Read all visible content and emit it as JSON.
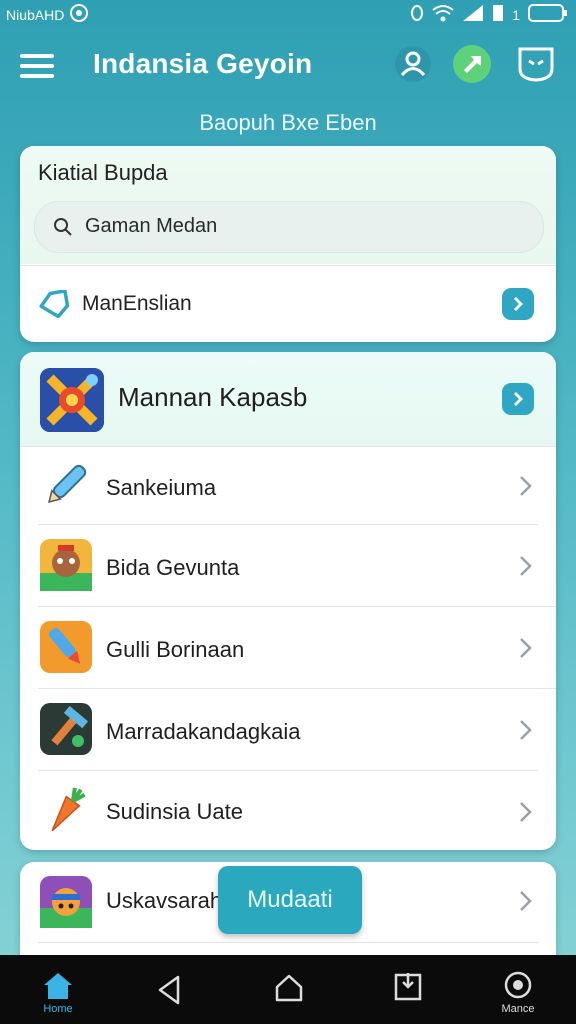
{
  "status_bar": {
    "left_text": "NiubAHD",
    "battery_text": "1"
  },
  "app_bar": {
    "title": "Indansia Geyoin"
  },
  "subtitle": "Baopuh Bxe Eben",
  "search_card": {
    "title": "Kiatial Bupda",
    "search_value": "Gaman Medan",
    "menu_label": "ManEnslian"
  },
  "apps_card": {
    "featured_label": "Mannan Kapasb",
    "items": [
      {
        "label": "Sankeiuma",
        "icon": "pencil-app-icon"
      },
      {
        "label": "Bida Gevunta",
        "icon": "character-app-icon"
      },
      {
        "label": "Gulli Borinaan",
        "icon": "brush-app-icon"
      },
      {
        "label": "Marradakandagkaia",
        "icon": "tools-app-icon"
      },
      {
        "label": "Sudinsia Uate",
        "icon": "carrot-app-icon"
      }
    ]
  },
  "bottom_card": {
    "items": [
      {
        "label": "Uskavsarah",
        "icon": "monster-app-icon"
      }
    ]
  },
  "fab": {
    "label": "Mudaati"
  },
  "navbar": {
    "home_label": "Home",
    "right_label": "Mance"
  },
  "colors": {
    "accent": "#2fa7c4",
    "background_top": "#2f9fb3",
    "navbar": "#0b0b0b"
  }
}
